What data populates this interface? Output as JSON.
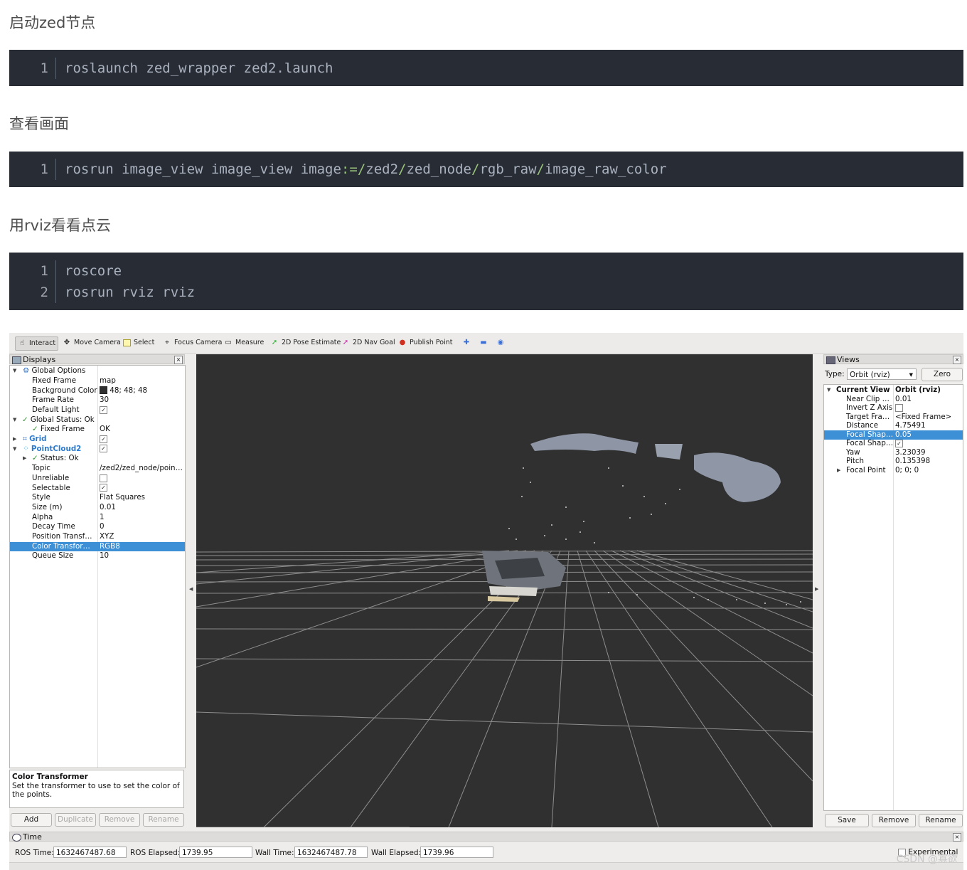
{
  "article": {
    "sections": [
      {
        "heading": "启动zed节点",
        "code": [
          "roslaunch zed_wrapper zed2.launch"
        ]
      },
      {
        "heading": "查看画面",
        "code": [
          "rosrun image_view image_view image:=/zed2/zed_node/rgb_raw/image_raw_color"
        ]
      },
      {
        "heading": "用rviz看看点云",
        "code": [
          "roscore",
          "rosrun rviz rviz"
        ]
      }
    ],
    "line_numbers": [
      "1",
      "1",
      "1",
      "2"
    ],
    "code_parts": {
      "s2_a": "rosrun image_view image_view image",
      "s2_op": ":=/",
      "s2_b": "zed2",
      "s2_slash1": "/",
      "s2_c": "zed_node",
      "s2_slash2": "/",
      "s2_d": "rgb_raw",
      "s2_slash3": "/",
      "s2_e": "image_raw_color"
    }
  },
  "rviz": {
    "toolbar": {
      "interact": "Interact",
      "move_camera": "Move Camera",
      "select": "Select",
      "focus_camera": "Focus Camera",
      "measure": "Measure",
      "pose_estimate": "2D Pose Estimate",
      "nav_goal": "2D Nav Goal",
      "publish_point": "Publish Point"
    },
    "displays": {
      "title": "Displays",
      "rows": [
        {
          "key": "Global Options",
          "value": ""
        },
        {
          "key": "Fixed Frame",
          "value": "map"
        },
        {
          "key": "Background Color",
          "value": "48; 48; 48"
        },
        {
          "key": "Frame Rate",
          "value": "30"
        },
        {
          "key": "Default Light",
          "value": "✓"
        },
        {
          "key": "Global Status: Ok",
          "value": ""
        },
        {
          "key": "Fixed Frame",
          "value": "OK"
        },
        {
          "key": "Grid",
          "value": "✓"
        },
        {
          "key": "PointCloud2",
          "value": "✓"
        },
        {
          "key": "Status: Ok",
          "value": ""
        },
        {
          "key": "Topic",
          "value": "/zed2/zed_node/poin…"
        },
        {
          "key": "Unreliable",
          "value": ""
        },
        {
          "key": "Selectable",
          "value": "✓"
        },
        {
          "key": "Style",
          "value": "Flat Squares"
        },
        {
          "key": "Size (m)",
          "value": "0.01"
        },
        {
          "key": "Alpha",
          "value": "1"
        },
        {
          "key": "Decay Time",
          "value": "0"
        },
        {
          "key": "Position Transf…",
          "value": "XYZ"
        },
        {
          "key": "Color Transfor…",
          "value": "RGB8"
        },
        {
          "key": "Queue Size",
          "value": "10"
        }
      ],
      "help_title": "Color Transformer",
      "help_text": "Set the transformer to use to set the color of the points.",
      "buttons": {
        "add": "Add",
        "duplicate": "Duplicate",
        "remove": "Remove",
        "rename": "Rename"
      }
    },
    "views": {
      "title": "Views",
      "type_label": "Type:",
      "type_value": "Orbit (rviz)",
      "zero": "Zero",
      "rows": [
        {
          "key": "Current View",
          "value": "Orbit (rviz)"
        },
        {
          "key": "Near Clip …",
          "value": "0.01"
        },
        {
          "key": "Invert Z Axis",
          "value": ""
        },
        {
          "key": "Target Fra…",
          "value": "<Fixed Frame>"
        },
        {
          "key": "Distance",
          "value": "4.75491"
        },
        {
          "key": "Focal Shap…",
          "value": "0.05"
        },
        {
          "key": "Focal Shap…",
          "value": "✓"
        },
        {
          "key": "Yaw",
          "value": "3.23039"
        },
        {
          "key": "Pitch",
          "value": "0.135398"
        },
        {
          "key": "Focal Point",
          "value": "0; 0; 0"
        }
      ],
      "buttons": {
        "save": "Save",
        "remove": "Remove",
        "rename": "Rename"
      }
    },
    "time": {
      "title": "Time",
      "ros_time_label": "ROS Time:",
      "ros_time": "1632467487.68",
      "ros_elapsed_label": "ROS Elapsed:",
      "ros_elapsed": "1739.95",
      "wall_time_label": "Wall Time:",
      "wall_time": "1632467487.78",
      "wall_elapsed_label": "Wall Elapsed:",
      "wall_elapsed": "1739.96",
      "experimental": "Experimental"
    },
    "watermark": "CSDN @寡欲"
  }
}
